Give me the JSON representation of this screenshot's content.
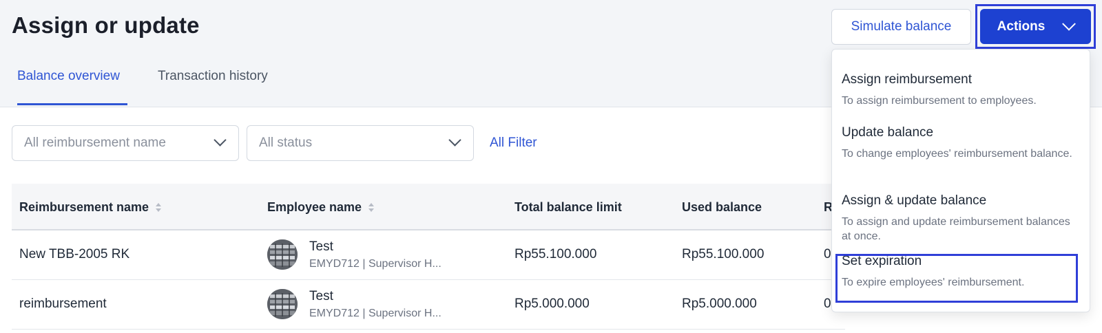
{
  "page": {
    "title": "Assign or update"
  },
  "tabs": [
    {
      "label": "Balance overview",
      "active": true
    },
    {
      "label": "Transaction history",
      "active": false
    }
  ],
  "header": {
    "simulate_label": "Simulate balance",
    "actions_label": "Actions"
  },
  "filters": {
    "reimbursement_placeholder": "All reimbursement name",
    "status_placeholder": "All status",
    "all_filter_label": "All Filter"
  },
  "table": {
    "columns": [
      "Reimbursement name",
      "Employee name",
      "Total balance limit",
      "Used balance",
      "R"
    ],
    "rows": [
      {
        "reimbursement": "New TBB-2005 RK",
        "employee_name": "Test",
        "employee_sub": "EMYD712 | Supervisor H...",
        "total": "Rp55.100.000",
        "used": "Rp55.100.000",
        "remaining": "0"
      },
      {
        "reimbursement": "reimbursement",
        "employee_name": "Test",
        "employee_sub": "EMYD712 | Supervisor H...",
        "total": "Rp5.000.000",
        "used": "Rp5.000.000",
        "remaining": "0"
      }
    ]
  },
  "actions_menu": [
    {
      "title": "Assign reimbursement",
      "desc": "To assign reimbursement to employees."
    },
    {
      "title": "Update balance",
      "desc": "To change employees' reimbursement balance."
    },
    {
      "title": "Assign & update balance",
      "desc": "To assign and update reimbursement balances at once."
    },
    {
      "title": "Set expiration",
      "desc": "To expire employees' reimbursement."
    }
  ],
  "colors": {
    "accent": "#2f55d4",
    "primary_button": "#1d41d1",
    "highlight": "#2f3fd8"
  }
}
